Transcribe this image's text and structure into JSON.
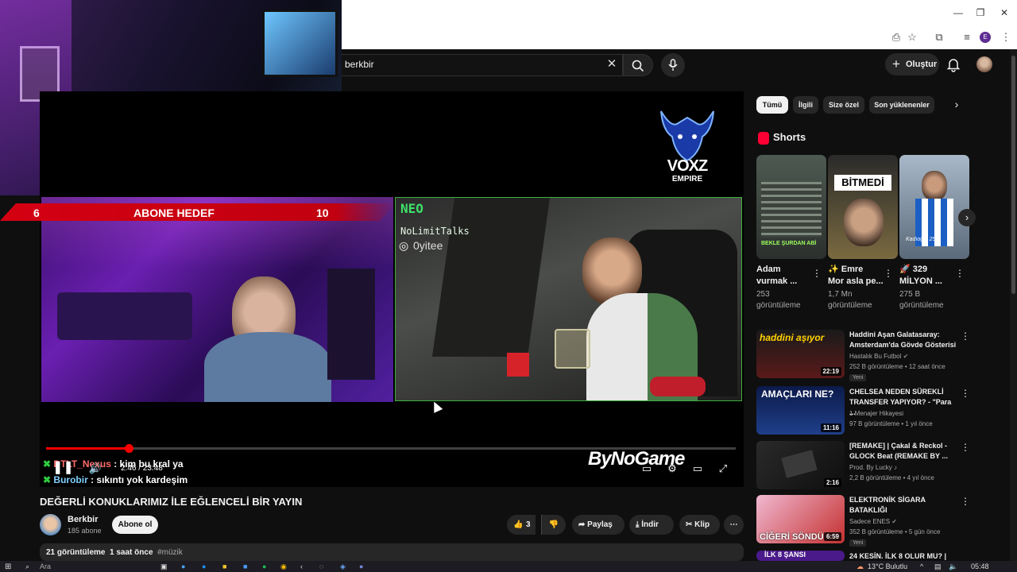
{
  "search": {
    "query": "berkbir"
  },
  "header": {
    "create_label": "Oluştur"
  },
  "overlay": {
    "subgoal_left": "6",
    "subgoal_label": "ABONE HEDEF",
    "subgoal_right": "10",
    "neo_channel": "NoLimitTalks",
    "instagram": "0yitee",
    "voxz_line1": "VOXZ",
    "voxz_line2": "EMPIRE",
    "brand": "ByNoGame",
    "chat": [
      {
        "user": "DTLT_Nexus",
        "message": ": kim bu kral ya"
      },
      {
        "user": "Burobir",
        "message": ": sıkıntı yok kardeşim"
      }
    ]
  },
  "player": {
    "time_display": "2:46 / 23:48",
    "progress_fraction": 0.12
  },
  "video": {
    "title": "DEĞERLİ KONUKLARIMIZ İLE EĞLENCELİ BİR YAYIN",
    "channel": "Berkbir",
    "subscribers": "185 abone",
    "subscribe_label": "Abone ol",
    "likes": "3",
    "share_label": "Paylaş",
    "download_label": "İndir",
    "clip_label": "Klip",
    "views": "21 görüntüleme",
    "age": "1 saat önce",
    "hashtag": "#müzik"
  },
  "chips": [
    "Tümü",
    "İlgili",
    "Size özel",
    "Son yüklenenler"
  ],
  "shorts": {
    "title": "Shorts",
    "items": [
      {
        "title_l1": "Adam",
        "title_l2": "vurmak ...",
        "views_l1": "253",
        "views_l2": "görüntüleme",
        "overlay": "BEKLE ŞURDAN ABİ"
      },
      {
        "title_l1": "✨ Emre",
        "title_l2": "Mor asla pe...",
        "views_l1": "1,7 Mn",
        "views_l2": "görüntüleme",
        "overlay": "BİTMEDİ"
      },
      {
        "title_l1": "🚀 329",
        "title_l2": "MİLYON ...",
        "views_l1": "275 B",
        "views_l2": "görüntüleme",
        "overlay": "Kadıoğlu 25"
      }
    ]
  },
  "recommendations": [
    {
      "title_l1": "Haddini Aşan Galatasaray:",
      "title_l2": "Amsterdam'da Gövde Gösterisi",
      "channel": "Hastalık Bu Futbol",
      "meta": "252 B görüntüleme • 12 saat önce",
      "badge": "Yeni",
      "duration": "22:19",
      "thumb_text": "haddini aşıyor"
    },
    {
      "title_l1": "CHELSEA NEDEN SÜREKLİ",
      "title_l2": "TRANSFER YAPIYOR? - \"Para ...",
      "channel": "1 Menajer Hikayesi",
      "meta": "97 B görüntüleme • 1 yıl önce",
      "badge": "",
      "duration": "11:16",
      "thumb_text": "AMAÇLARI NE?"
    },
    {
      "title_l1": "[REMAKE] | Çakal & Reckol -",
      "title_l2": "GLOCK Beat (REMAKE BY ...",
      "channel": "Prod. By Lucky ♪",
      "meta": "2,2 B görüntüleme • 4 yıl önce",
      "badge": "",
      "duration": "2:16",
      "thumb_text": ""
    },
    {
      "title_l1": "ELEKTRONİK SİGARA",
      "title_l2": "BATAKLIĞI",
      "channel": "Sadece ENES",
      "meta": "352 B görüntüleme • 5 gün önce",
      "badge": "Yeni",
      "duration": "6:59",
      "thumb_text": "CİĞERİ SÖNDÜ"
    },
    {
      "title_l1": "24 KESİN. İLK 8 OLUR MU? |",
      "title_l2": "",
      "channel": "",
      "meta": "",
      "badge": "",
      "duration": "",
      "thumb_text": "İLK 8 ŞANSI"
    }
  ],
  "taskbar": {
    "search_placeholder": "Ara",
    "weather": "13°C  Bulutlu",
    "clock": "05:48"
  },
  "colors": {
    "accent_red": "#ff0000",
    "bg": "#0f0f0f",
    "chip": "#272727",
    "neo_green": "#3fae3f"
  }
}
